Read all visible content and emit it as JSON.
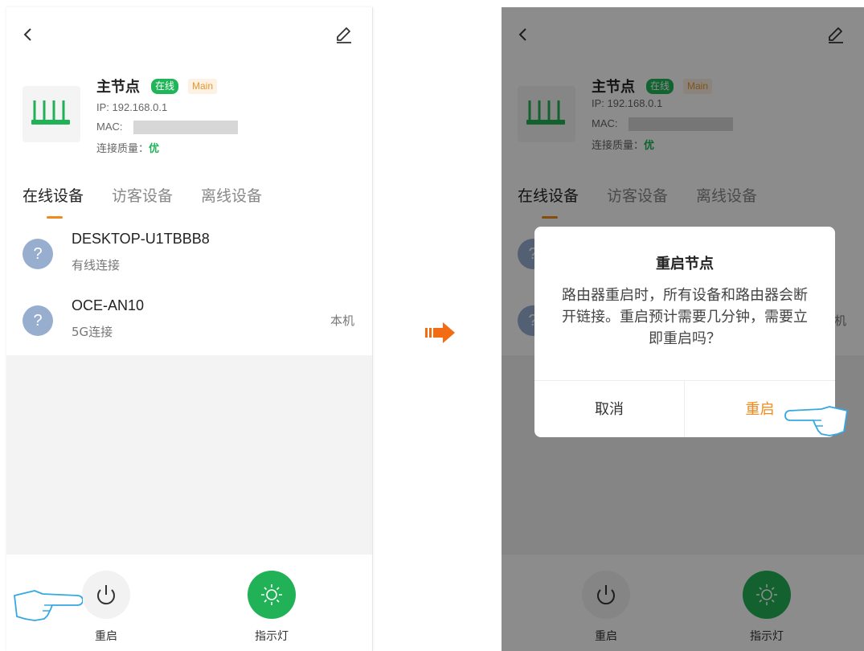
{
  "colors": {
    "online_green": "#20b558",
    "accent_orange": "#f28a1b",
    "device_icon_blue": "#97aecf"
  },
  "node": {
    "name": "主节点",
    "status_badge": "在线",
    "role_badge": "Main",
    "ip": "IP:  192.168.0.1",
    "mac_label": "MAC:",
    "quality_label": "连接质量：",
    "quality_value": "优"
  },
  "tabs": [
    "在线设备",
    "访客设备",
    "离线设备"
  ],
  "devices": [
    {
      "icon": "?",
      "name": "DESKTOP-U1TBBB8",
      "connection": "有线连接",
      "local": ""
    },
    {
      "icon": "?",
      "name": "OCE-AN10",
      "connection": "5G连接",
      "local": "本机"
    }
  ],
  "actions": {
    "reboot_label": "重启",
    "led_label": "指示灯"
  },
  "dialog": {
    "title": "重启节点",
    "message": "路由器重启时，所有设备和路由器会断开链接。重启预计需要几分钟，需要立即重启吗？",
    "cancel": "取消",
    "confirm": "重启"
  },
  "icons": [
    "back-icon",
    "edit-icon",
    "router-icon",
    "power-icon",
    "sun-icon",
    "pointing-hand-icon",
    "arrow-right-icon"
  ]
}
